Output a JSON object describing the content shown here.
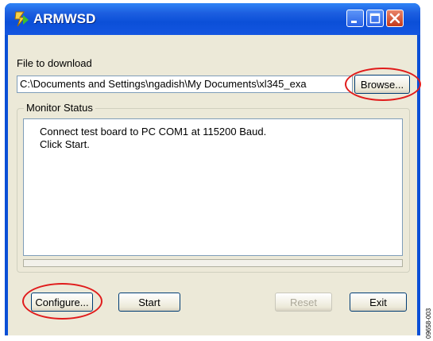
{
  "window": {
    "title": "ARMWSD",
    "icon": "app-lightning-icon",
    "controls": {
      "minimize": "minimize-icon",
      "maximize": "maximize-icon",
      "close": "close-icon"
    }
  },
  "download": {
    "label": "File to download",
    "path": "C:\\Documents and Settings\\ngadish\\My Documents\\xl345_exa",
    "browse_label": "Browse..."
  },
  "monitor": {
    "group_label": "Monitor Status",
    "lines": [
      "Connect test board to PC COM1 at 115200 Baud.",
      "Click Start."
    ]
  },
  "buttons": {
    "configure": "Configure...",
    "start": "Start",
    "reset": "Reset",
    "exit": "Exit"
  },
  "figure_code": "09658-003",
  "colors": {
    "titlebar": "#0b4fd8",
    "client": "#ece9d8",
    "highlight_circle": "#e01b1b"
  }
}
